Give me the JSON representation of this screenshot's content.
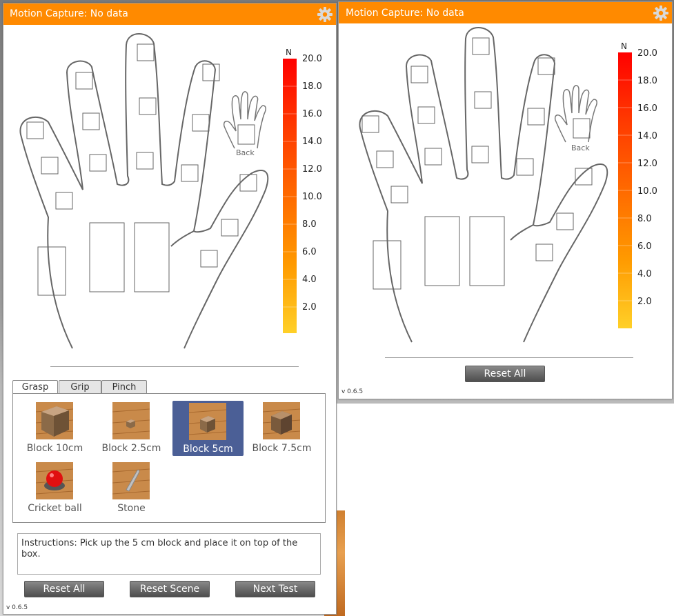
{
  "left_panel": {
    "title": "Motion Capture: No data",
    "back_label": "Back",
    "scale": {
      "unit": "N",
      "ticks": [
        "20.0",
        "18.0",
        "16.0",
        "14.0",
        "12.0",
        "10.0",
        "8.0",
        "6.0",
        "4.0",
        "2.0"
      ]
    },
    "tabs": [
      {
        "label": "Grasp",
        "active": true
      },
      {
        "label": "Grip",
        "active": false
      },
      {
        "label": "Pinch",
        "active": false
      }
    ],
    "objects": [
      {
        "label": "Block 10cm",
        "icon": "block-large-icon",
        "selected": false
      },
      {
        "label": "Block 2.5cm",
        "icon": "block-small-icon",
        "selected": false
      },
      {
        "label": "Block 5cm",
        "icon": "block-medium-icon",
        "selected": true
      },
      {
        "label": "Block 7.5cm",
        "icon": "block-medium-large-icon",
        "selected": false
      },
      {
        "label": "Cricket ball",
        "icon": "cricket-ball-icon",
        "selected": false
      },
      {
        "label": "Stone",
        "icon": "stone-icon",
        "selected": false
      }
    ],
    "instructions": "Instructions: Pick up the 5 cm block and place it on top of the box.",
    "buttons": {
      "reset_all": "Reset All",
      "reset_scene": "Reset Scene",
      "next_test": "Next Test"
    },
    "version": "v 0.6.5"
  },
  "right_panel": {
    "title": "Motion Capture: No data",
    "back_label": "Back",
    "scale": {
      "unit": "N",
      "ticks": [
        "20.0",
        "18.0",
        "16.0",
        "14.0",
        "12.0",
        "10.0",
        "8.0",
        "6.0",
        "4.0",
        "2.0"
      ]
    },
    "buttons": {
      "reset_all": "Reset All"
    },
    "version": "v 0.6.5"
  },
  "colors": {
    "titlebar": "#ff8a00",
    "selected_item": "#4b5f96",
    "scale_top": "#ff0000",
    "scale_bottom": "#ffd020"
  }
}
